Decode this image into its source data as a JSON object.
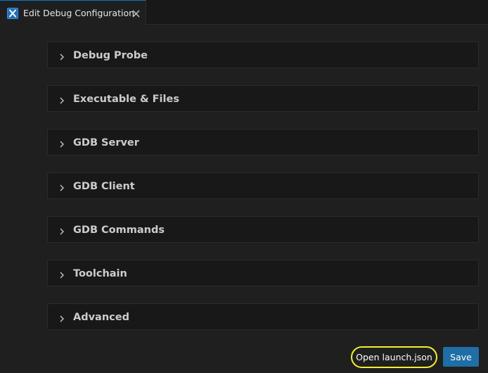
{
  "tab": {
    "title": "Edit Debug Configuration",
    "icon": "debug-config-icon",
    "close_icon": "close-icon"
  },
  "sections": [
    {
      "label": "Debug Probe",
      "icon": "chevron-right-icon",
      "expanded": false
    },
    {
      "label": "Executable & Files",
      "icon": "chevron-right-icon",
      "expanded": false
    },
    {
      "label": "GDB Server",
      "icon": "chevron-right-icon",
      "expanded": false
    },
    {
      "label": "GDB Client",
      "icon": "chevron-right-icon",
      "expanded": false
    },
    {
      "label": "GDB Commands",
      "icon": "chevron-right-icon",
      "expanded": false
    },
    {
      "label": "Toolchain",
      "icon": "chevron-right-icon",
      "expanded": false
    },
    {
      "label": "Advanced",
      "icon": "chevron-right-icon",
      "expanded": false
    }
  ],
  "actions": {
    "open_launch_json_label": "Open launch.json",
    "save_label": "Save"
  },
  "colors": {
    "background": "#1f1f1f",
    "section_background": "#181818",
    "save_button": "#1f6ea5",
    "highlight_ring": "#f2ef2d",
    "active_tab_border": "#0078d4"
  }
}
